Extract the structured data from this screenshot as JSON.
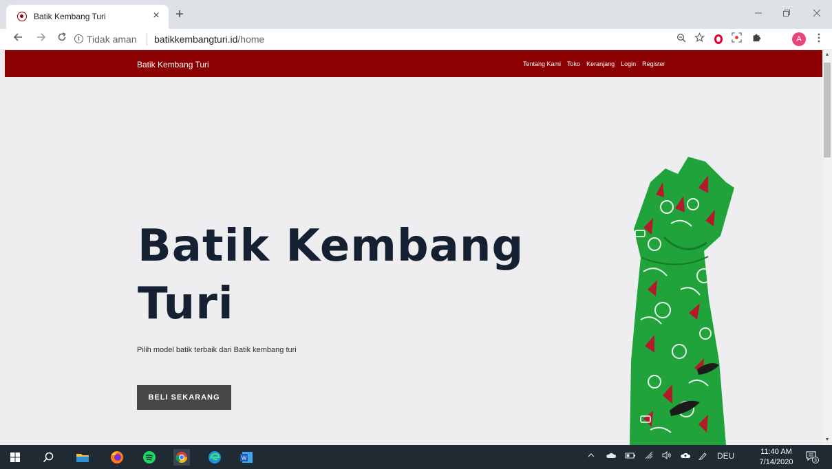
{
  "browser": {
    "tab_title": "Batik Kembang Turi",
    "tab_close": "×",
    "new_tab": "+",
    "not_secure": "Tidak aman",
    "url_host": "batikkembangturi.id",
    "url_path": "/home",
    "profile_initial": "A"
  },
  "site": {
    "brand": "Batik Kembang Turi",
    "nav": [
      "Tentang Kami",
      "Toko",
      "Keranjang",
      "Login",
      "Register"
    ],
    "hero_title": "Batik Kembang Turi",
    "hero_subtitle": "Pilih model batik terbaik dari Batik kembang turi",
    "cta_label": "BELI SEKARANG",
    "colors": {
      "nav_bg": "#8b0000",
      "hero_text": "#152032",
      "cta_bg": "#474747",
      "dress_green": "#1fa33a"
    }
  },
  "taskbar": {
    "language": "DEU",
    "time": "11:40 AM",
    "date": "7/14/2020",
    "notification_count": "3"
  }
}
